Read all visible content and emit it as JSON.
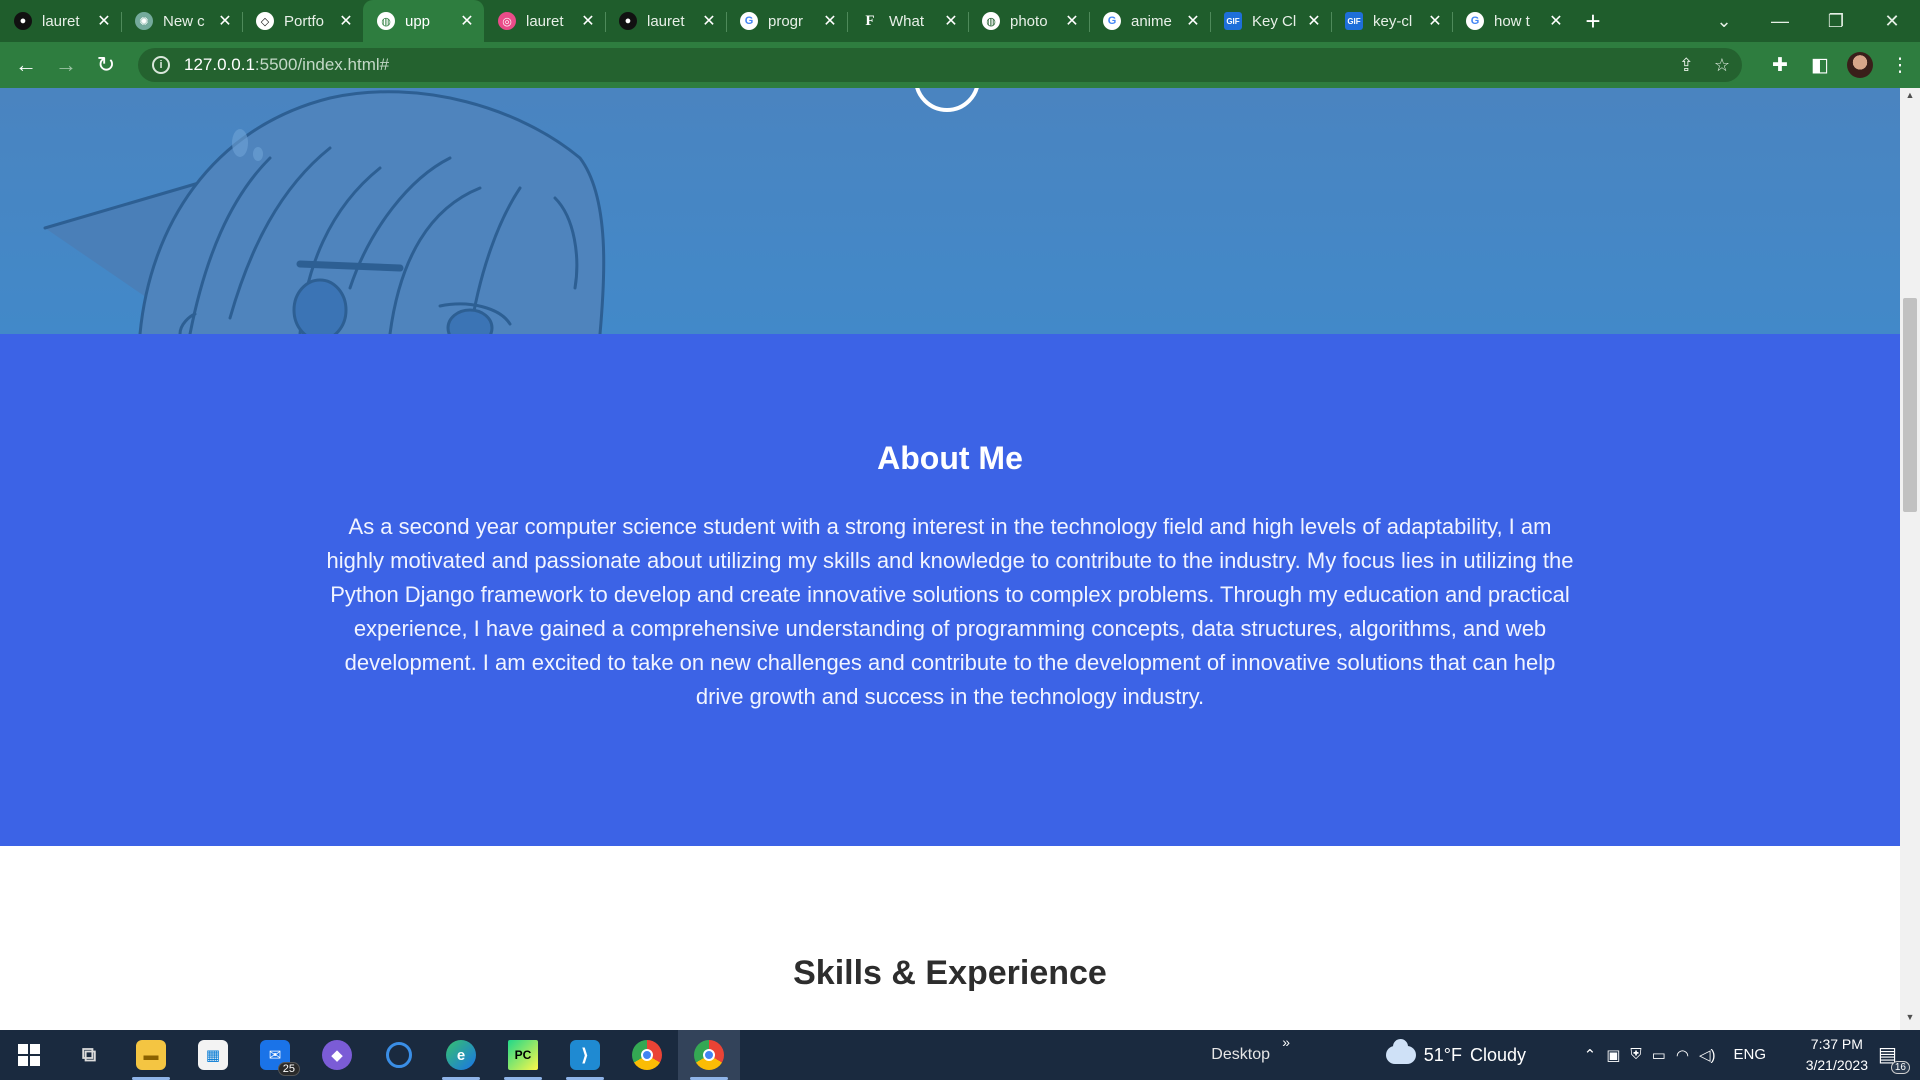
{
  "browser": {
    "tabs": [
      {
        "title": "lauret",
        "favicon": "github-icon",
        "active": false
      },
      {
        "title": "New c",
        "favicon": "chatgpt-icon",
        "active": false
      },
      {
        "title": "Portfo",
        "favicon": "codepen-icon",
        "active": false
      },
      {
        "title": "upp",
        "favicon": "globe-icon",
        "active": true
      },
      {
        "title": "lauret",
        "favicon": "dribbble-icon",
        "active": false
      },
      {
        "title": "lauret",
        "favicon": "github-icon",
        "active": false
      },
      {
        "title": "progr",
        "favicon": "google-icon",
        "active": false
      },
      {
        "title": "What",
        "favicon": "f-icon",
        "active": false
      },
      {
        "title": "photo",
        "favicon": "globe-icon",
        "active": false
      },
      {
        "title": "anime",
        "favicon": "google-icon",
        "active": false
      },
      {
        "title": "Key Cl",
        "favicon": "gif-icon",
        "active": false
      },
      {
        "title": "key-cl",
        "favicon": "gif-icon",
        "active": false
      },
      {
        "title": "how t",
        "favicon": "google-icon",
        "active": false
      }
    ],
    "url_host": "127.0.0.1",
    "url_rest": ":5500/index.html#",
    "theme_color": "#2e7d3f"
  },
  "page": {
    "about": {
      "heading": "About Me",
      "text": "As a second year computer science student with a strong interest in the technology field and high levels of adaptability, I am highly motivated and passionate about utilizing my skills and knowledge to contribute to the industry. My focus lies in utilizing the Python Django framework to develop and create innovative solutions to complex problems. Through my education and practical experience, I have gained a comprehensive understanding of programming concepts, data structures, algorithms, and web development. I am excited to take on new challenges and contribute to the development of innovative solutions that can help drive growth and success in the technology industry.",
      "bg_color": "#3c63e6"
    },
    "skills": {
      "heading": "Skills & Experience"
    },
    "hero_color": "#4289c9"
  },
  "taskbar": {
    "apps": [
      {
        "name": "start-icon",
        "running": false
      },
      {
        "name": "task-view-icon",
        "running": false
      },
      {
        "name": "file-explorer-icon",
        "running": true
      },
      {
        "name": "microsoft-store-icon",
        "running": false
      },
      {
        "name": "mail-icon",
        "running": false,
        "badge": "25"
      },
      {
        "name": "clipchamp-icon",
        "running": false
      },
      {
        "name": "cortana-icon",
        "running": false
      },
      {
        "name": "edge-icon",
        "running": true
      },
      {
        "name": "pycharm-icon",
        "running": true
      },
      {
        "name": "vscode-icon",
        "running": true
      },
      {
        "name": "chrome-icon",
        "running": false
      },
      {
        "name": "chrome-profile-icon",
        "running": true,
        "focused": true
      }
    ],
    "desktop_label": "Desktop",
    "weather": {
      "temp": "51°F",
      "condition": "Cloudy"
    },
    "language": "ENG",
    "time": "7:37 PM",
    "date": "3/21/2023",
    "notification_count": "16"
  }
}
